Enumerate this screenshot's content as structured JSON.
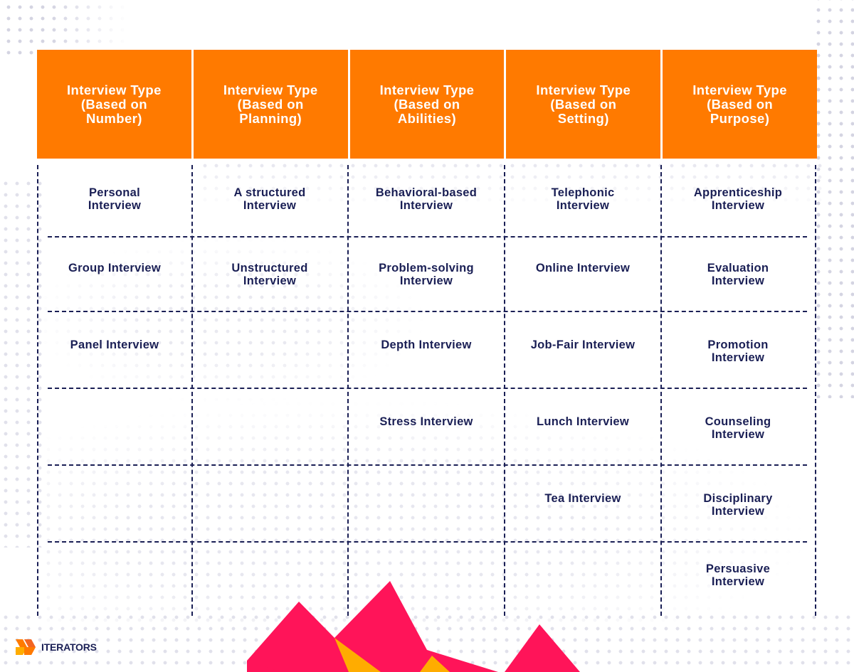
{
  "colors": {
    "header_bg": "#ff7a00",
    "header_text": "#ffffff",
    "text": "#1a1f55",
    "grid_line": "#1a1f55",
    "accent_pink": "#ff1459",
    "accent_yellow": "#ffac00"
  },
  "table": {
    "columns": [
      {
        "header": "Interview Type\n(Based on\nNumber)",
        "items": [
          "Personal\nInterview",
          "Group Interview",
          "Panel Interview",
          "",
          "",
          ""
        ]
      },
      {
        "header": "Interview Type\n(Based on\nPlanning)",
        "items": [
          "A structured\nInterview",
          "Unstructured\nInterview",
          "",
          "",
          "",
          ""
        ]
      },
      {
        "header": "Interview Type\n(Based on\nAbilities)",
        "items": [
          "Behavioral-based\nInterview",
          "Problem-solving\nInterview",
          "Depth Interview",
          "Stress Interview",
          "",
          ""
        ]
      },
      {
        "header": "Interview Type\n(Based on\nSetting)",
        "items": [
          "Telephonic\nInterview",
          "Online Interview",
          "Job-Fair Interview",
          "Lunch Interview",
          "Tea Interview",
          ""
        ]
      },
      {
        "header": "Interview Type\n(Based on\nPurpose)",
        "items": [
          "Apprenticeship\nInterview",
          "Evaluation\nInterview",
          "Promotion\nInterview",
          "Counseling\nInterview",
          "Disciplinary\nInterview",
          "Persuasive\nInterview"
        ]
      }
    ]
  },
  "logo": {
    "text": "ITERATORS",
    "icon": "chevron-arrows-logo-icon"
  }
}
